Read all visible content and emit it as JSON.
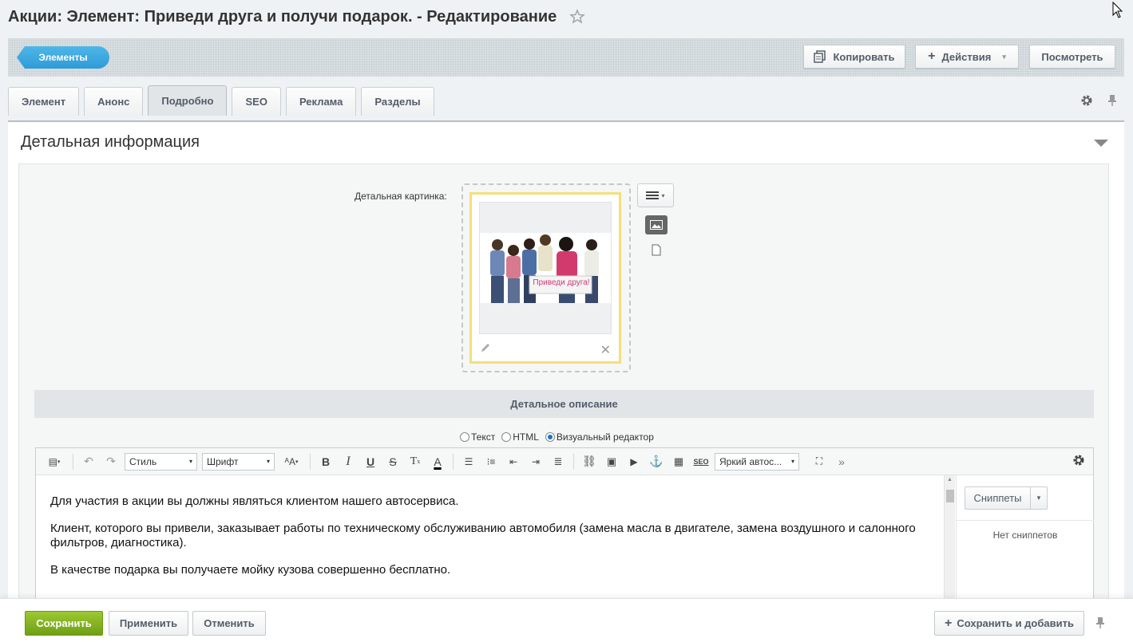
{
  "page": {
    "title": "Акции: Элемент: Приведи друга и получи подарок. - Редактирование"
  },
  "toolbar": {
    "elements_label": "Элементы",
    "copy_label": "Копировать",
    "actions_label": "Действия",
    "view_label": "Посмотреть"
  },
  "tabs": [
    {
      "label": "Элемент"
    },
    {
      "label": "Анонс"
    },
    {
      "label": "Подробно",
      "active": true
    },
    {
      "label": "SEO"
    },
    {
      "label": "Реклама"
    },
    {
      "label": "Разделы"
    }
  ],
  "section": {
    "title": "Детальная информация",
    "picture_label": "Детальная картинка:",
    "picture_text": "Приведи друга!",
    "description_header": "Детальное описание"
  },
  "editor_mode": {
    "options": [
      "Текст",
      "HTML",
      "Визуальный редактор"
    ],
    "selected": "Визуальный редактор"
  },
  "editor": {
    "style_select": "Стиль",
    "font_select": "Шрифт",
    "template_select": "Яркий автос...",
    "seo_label": "SEO",
    "paragraphs": [
      "Для участия в акции вы должны являться клиентом нашего автосервиса.",
      "Клиент, которого вы привели, заказывает работы по техническому обслуживанию автомобиля (замена масла в двигателе, замена воздушного и салонного фильтров, диагностика).",
      "В качестве подарка вы получаете мойку кузова совершенно бесплатно."
    ],
    "snippets_label": "Сниппеты",
    "no_snippets": "Нет сниппетов"
  },
  "footer": {
    "save_label": "Сохранить",
    "apply_label": "Применить",
    "cancel_label": "Отменить",
    "save_add_label": "Сохранить и добавить"
  },
  "colors": {
    "accent_blue": "#2e9bd7",
    "save_green": "#7fb21e",
    "frame_yellow": "#f3e07a"
  }
}
